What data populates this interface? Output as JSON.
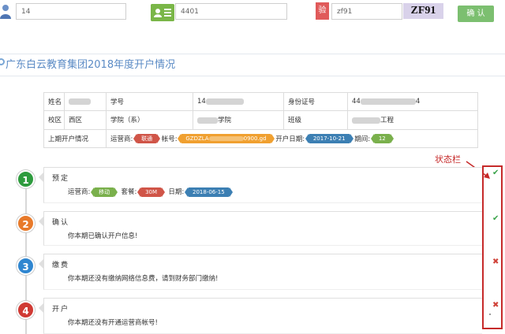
{
  "login": {
    "username_value": "14",
    "id_value": "4401",
    "captcha_value": "zf91",
    "captcha_code": "ZF91",
    "captcha_icon_text": "验",
    "confirm_label": "确 认"
  },
  "page": {
    "title": "广东白云教育集团2018年度开户情况"
  },
  "info": {
    "name_label": "姓名",
    "student_no_label": "学号",
    "student_no_value": "14",
    "id_label": "身份证号",
    "id_value": "44",
    "id_value_end": "4",
    "campus_label": "校区",
    "campus_value": "西区",
    "school_label": "学院（系）",
    "school_value": "学院",
    "class_label": "班级",
    "class_value": "工程",
    "last_period_label": "上期开户情况",
    "carrier_label": "运营商:",
    "carrier_value": "联通",
    "account_label": "帐号:",
    "account_value": "GZDZLA",
    "account_value_end": "0900.gd",
    "open_date_label": "开户日期:",
    "open_date_value": "2017-10-21",
    "period_label": "期间:",
    "period_value": "12"
  },
  "status_label": "状态栏",
  "steps": [
    {
      "number": "1",
      "title": "预定",
      "carrier_label": "运营商:",
      "carrier_value": "移动",
      "plan_label": "套餐:",
      "plan_value": "30M",
      "date_label": "日期:",
      "date_value": "2018-06-15",
      "status": "✔"
    },
    {
      "number": "2",
      "title": "确认",
      "message": "你本期已确认开户信息!",
      "status": "✔"
    },
    {
      "number": "3",
      "title": "缴费",
      "message": "你本期还没有缴纳网络信息费，请到财务部门缴纳!",
      "status": "✖"
    },
    {
      "number": "4",
      "title": "开户",
      "message": "你本期还没有开通运营商帐号!",
      "status": "✖"
    }
  ],
  "colors": {
    "step1": "#2e9b3e",
    "step2": "#e87a2a",
    "step3": "#2f86d0",
    "step4": "#d03a34",
    "status_box": "#c62a2a"
  }
}
